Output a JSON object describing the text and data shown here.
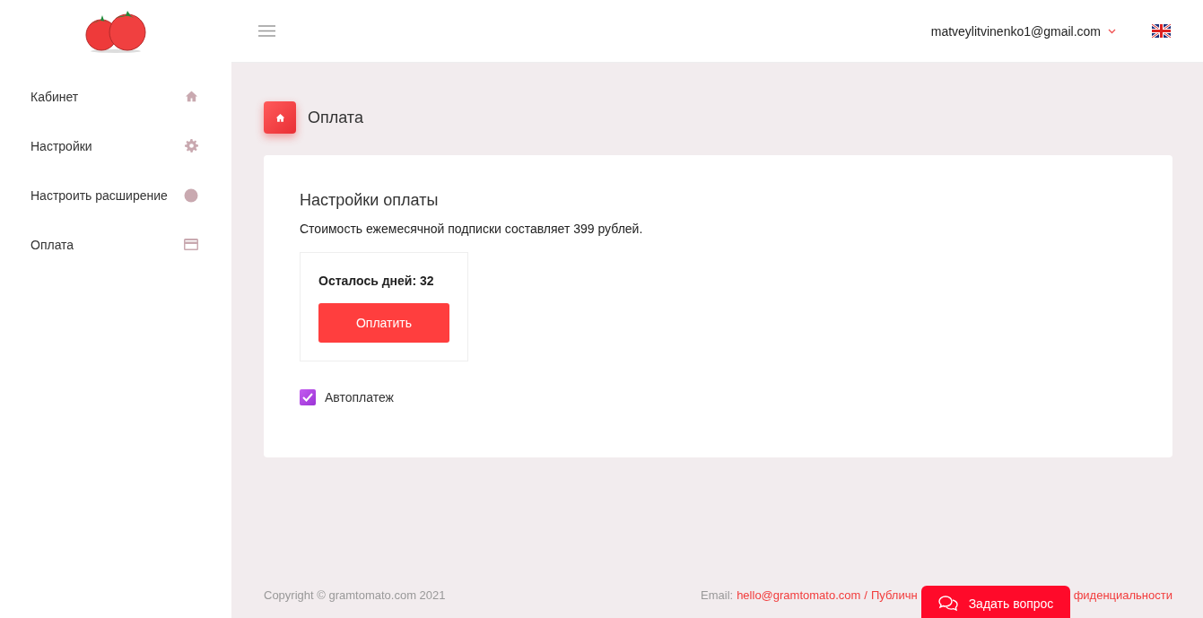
{
  "header": {
    "user_email": "matveylitvinenko1@gmail.com"
  },
  "sidebar": {
    "items": [
      {
        "label": "Кабинет",
        "kind": "home",
        "selected": false
      },
      {
        "label": "Настройки",
        "kind": "settings",
        "selected": false
      },
      {
        "label": "Настроить расширение",
        "kind": "extension",
        "selected": false
      },
      {
        "label": "Оплата",
        "kind": "payment",
        "selected": false
      }
    ]
  },
  "page_title": "Оплата",
  "card": {
    "title": "Настройки оплаты",
    "description": "Стоимость ежемесячной подписки составляет 399 рублей.",
    "days_left": "Осталось дней: 32",
    "pay_button": "Оплатить",
    "autopay": {
      "label": "Автоплатеж",
      "checked": true
    }
  },
  "footer": {
    "copyright": "Copyright © gramtomato.com 2021",
    "email_label": "Email:",
    "email": "hello@gramtomato.com",
    "separator": "/",
    "link_start": "Публичн",
    "link_end": "фиденциальности"
  },
  "chat_button": "Задать вопрос"
}
